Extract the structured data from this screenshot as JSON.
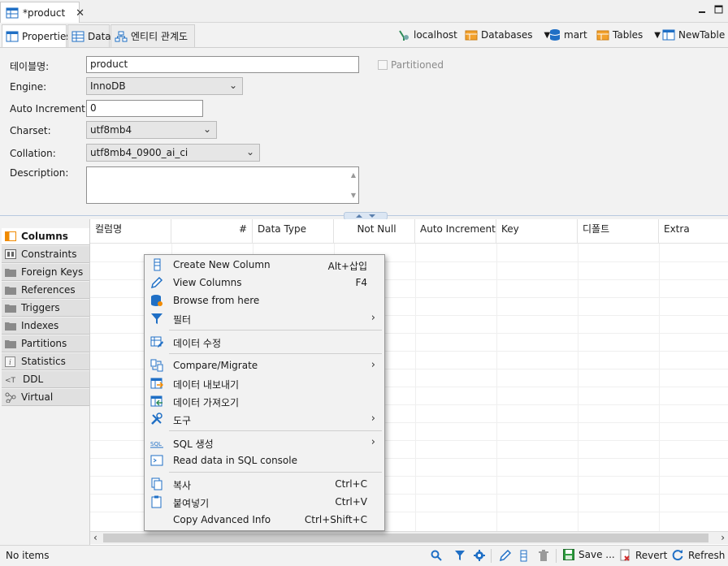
{
  "editor_tab": {
    "title": "*product",
    "close": "✕"
  },
  "subtabs": [
    {
      "label": "Properties"
    },
    {
      "label": "Data"
    },
    {
      "label": "엔티티 관계도"
    }
  ],
  "toolbar": {
    "localhost": "localhost",
    "databases": "Databases",
    "mart": "mart",
    "tables": "Tables",
    "newtable": "NewTable"
  },
  "form": {
    "table_name_label": "테이블명:",
    "table_name_value": "product",
    "partitioned_label": "Partitioned",
    "engine_label": "Engine:",
    "engine_value": "InnoDB",
    "auto_increment_label": "Auto Increment:",
    "auto_increment_value": "0",
    "charset_label": "Charset:",
    "charset_value": "utf8mb4",
    "collation_label": "Collation:",
    "collation_value": "utf8mb4_0900_ai_ci",
    "description_label": "Description:",
    "description_value": ""
  },
  "left_tabs": [
    {
      "label": "Columns",
      "icon": "columns-icon"
    },
    {
      "label": "Constraints",
      "icon": "constraints-icon"
    },
    {
      "label": "Foreign Keys",
      "icon": "folder-icon"
    },
    {
      "label": "References",
      "icon": "folder-icon"
    },
    {
      "label": "Triggers",
      "icon": "folder-icon"
    },
    {
      "label": "Indexes",
      "icon": "folder-icon"
    },
    {
      "label": "Partitions",
      "icon": "folder-icon"
    },
    {
      "label": "Statistics",
      "icon": "info-icon"
    },
    {
      "label": "DDL",
      "icon": "ddl-icon"
    },
    {
      "label": "Virtual",
      "icon": "virtual-icon"
    }
  ],
  "grid_headers": [
    "컬럼명",
    "#",
    "Data Type",
    "Not Null",
    "Auto Increment",
    "Key",
    "디폴트",
    "Extra"
  ],
  "context_menu": [
    {
      "label": "Create New Column",
      "shortcut": "Alt+삽입",
      "submenu": false,
      "icon": "column-add-icon"
    },
    {
      "label": "View Columns",
      "shortcut": "F4",
      "submenu": false,
      "icon": "pencil-icon"
    },
    {
      "label": "Browse from here",
      "shortcut": "",
      "submenu": false,
      "icon": "database-icon"
    },
    {
      "label": "필터",
      "shortcut": "",
      "submenu": true,
      "icon": "filter-icon"
    },
    {
      "label": "데이터 수정",
      "shortcut": "",
      "submenu": false,
      "icon": "edit-data-icon"
    },
    {
      "label": "Compare/Migrate",
      "shortcut": "",
      "submenu": true,
      "icon": "compare-icon"
    },
    {
      "label": "데이터 내보내기",
      "shortcut": "",
      "submenu": false,
      "icon": "export-icon"
    },
    {
      "label": "데이터 가져오기",
      "shortcut": "",
      "submenu": false,
      "icon": "import-icon"
    },
    {
      "label": "도구",
      "shortcut": "",
      "submenu": true,
      "icon": "tools-icon"
    },
    {
      "label": "SQL 생성",
      "shortcut": "",
      "submenu": true,
      "icon": "sql-icon"
    },
    {
      "label": "Read data in SQL console",
      "shortcut": "",
      "submenu": false,
      "icon": "console-icon"
    },
    {
      "label": "복사",
      "shortcut": "Ctrl+C",
      "submenu": false,
      "icon": "copy-icon"
    },
    {
      "label": "붙여넣기",
      "shortcut": "Ctrl+V",
      "submenu": false,
      "icon": "paste-icon"
    },
    {
      "label": "Copy Advanced Info",
      "shortcut": "Ctrl+Shift+C",
      "submenu": false,
      "icon": ""
    }
  ],
  "submenu_arrow": "›",
  "status": {
    "text": "No items",
    "save": "Save ...",
    "revert": "Revert",
    "refresh": "Refresh"
  },
  "colors": {
    "accent_blue": "#1f6fc5",
    "folder_gray": "#8a8a8a",
    "columns_orange": "#f08a00"
  }
}
